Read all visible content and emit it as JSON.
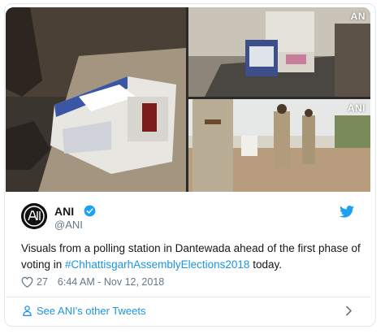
{
  "media": {
    "watermark_top": "AN",
    "watermark_bottom": "ANI"
  },
  "author": {
    "name": "ANI",
    "handle": "@ANI"
  },
  "tweet": {
    "text_before": "Visuals from a polling station in Dantewada ahead of the first phase of voting in ",
    "hashtag": "#ChhattisgarhAssemblyElections2018",
    "text_after": " today."
  },
  "meta": {
    "likes": "27",
    "timestamp": "6:44 AM - Nov 12, 2018"
  },
  "footer": {
    "see_others_label": "See ANI's other Tweets"
  },
  "colors": {
    "link": "#1b95e0",
    "verified": "#1da1f2",
    "text": "#14171a",
    "muted": "#657786"
  },
  "icons": [
    "heart-icon",
    "verified-badge-icon",
    "twitter-bird-icon",
    "person-icon",
    "chevron-right-icon"
  ]
}
